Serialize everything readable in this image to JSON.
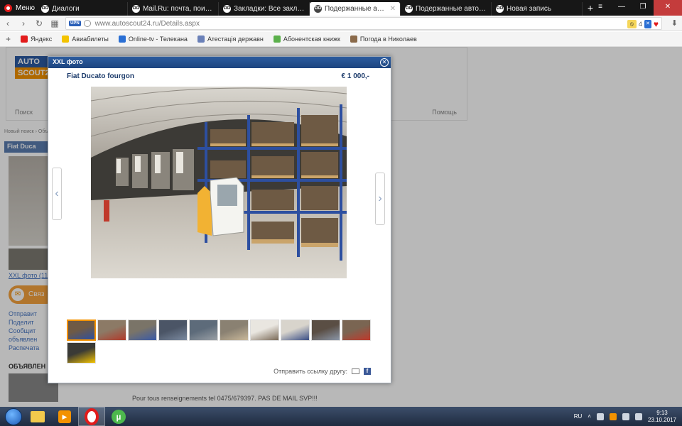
{
  "browser": {
    "menu_label": "Меню",
    "tabs": [
      {
        "title": "Диалоги",
        "active": false
      },
      {
        "title": "Mail.Ru: почта, поиск в и",
        "active": false
      },
      {
        "title": "Закладки: Все закладки",
        "active": false
      },
      {
        "title": "Подержанные автомоби",
        "active": true
      },
      {
        "title": "Подержанные автомоби",
        "active": false
      },
      {
        "title": "Новая запись",
        "active": false
      }
    ],
    "url": "www.autoscout24.ru/Details.aspx",
    "upn_label": "UPN",
    "adblock_count": "4",
    "bookmarks": [
      {
        "label": "Яндекс",
        "color": "#e21b1b"
      },
      {
        "label": "Авиабилеты",
        "color": "#f3c300"
      },
      {
        "label": "Online-tv - Телекана",
        "color": "#2a6fd4"
      },
      {
        "label": "Атестація державн",
        "color": "#6a80b8"
      },
      {
        "label": "Абонентская книжк",
        "color": "#5bb04b"
      },
      {
        "label": "Погода в Николаев",
        "color": "#8a6a4a"
      }
    ]
  },
  "site": {
    "logo_top": "AUTO",
    "logo_bottom": "SCOUT24",
    "nav_left": "Поиск",
    "nav_right": "Помощь",
    "breadcrumb": "Новый поиск › Объ",
    "sidebar_title": "Fiat Duca",
    "xxl_link": "XXL фото (11",
    "contact_label": "Связ",
    "side_links": [
      "Отправит",
      "Поделит",
      "Сообщит объявлен",
      "Распечата"
    ],
    "ads_title": "ОБЪЯВЛЕН",
    "description": "Pour tous renseignements tel 0475/679397. PAS DE MAIL SVP!!!"
  },
  "modal": {
    "header": "XXL фото",
    "car_title": "Fiat Ducato fourgon",
    "price": "€ 1 000,-",
    "thumb_count": 11,
    "selected_thumb": 0,
    "share_label": "Отправить ссылку другу:",
    "icons": {
      "close": "close-icon",
      "prev": "chevron-left-icon",
      "next": "chevron-right-icon",
      "mail": "mail-icon",
      "facebook": "facebook-icon"
    }
  },
  "taskbar": {
    "apps": [
      "explorer",
      "media-player",
      "opera",
      "utorrent"
    ],
    "active_app": "opera",
    "lang": "RU",
    "time": "9:13",
    "date": "23.10.2017"
  },
  "colors": {
    "accent_blue": "#1d4580",
    "brand_orange": "#f39200",
    "opera_red": "#e21b1b"
  }
}
